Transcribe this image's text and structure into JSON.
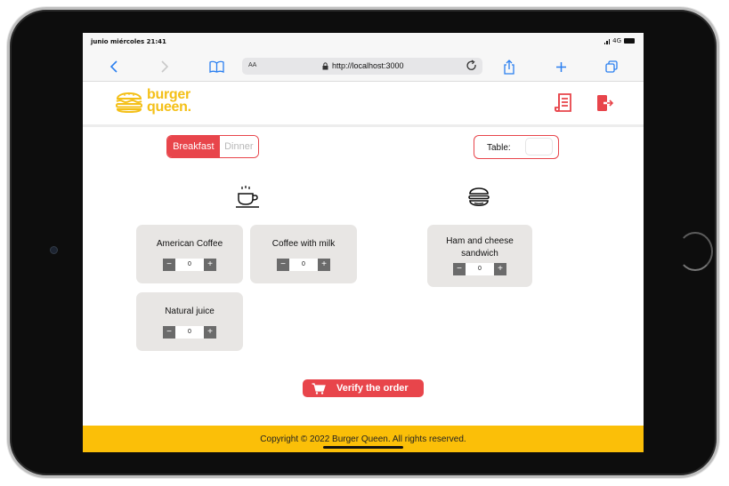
{
  "status_bar": {
    "time": "junio miércoles 21:41",
    "network": "4G"
  },
  "browser": {
    "aa_label": "AA",
    "url": "http://localhost:3000",
    "icons": [
      "back-icon",
      "forward-icon",
      "bookmarks-icon",
      "lock-icon",
      "reload-icon",
      "share-icon",
      "new-tab-icon",
      "tabs-icon"
    ]
  },
  "header": {
    "logo_line1": "burger",
    "logo_line2": "queen.",
    "brand_color": "#f4c018",
    "accent_color": "#e8454b",
    "icons": [
      "orders-list-icon",
      "logout-icon"
    ]
  },
  "menu_toggle": {
    "options": [
      "Breakfast",
      "Dinner"
    ],
    "selected": "Breakfast"
  },
  "table": {
    "label": "Table:",
    "value": ""
  },
  "categories": [
    {
      "icon": "coffee-cup-icon"
    },
    {
      "icon": "burger-icon"
    }
  ],
  "products": [
    {
      "name": "American Coffee",
      "quantity": "0"
    },
    {
      "name": "Coffee with milk",
      "quantity": "0"
    },
    {
      "name": "Natural juice",
      "quantity": "0"
    },
    {
      "name": "Ham and cheese sandwich",
      "quantity": "0"
    }
  ],
  "stepper": {
    "minus": "−",
    "plus": "+"
  },
  "verify_button": {
    "label": "Verify the order",
    "icon": "cart-icon"
  },
  "footer": {
    "text": "Copyright © 2022 Burger Queen. All rights reserved.",
    "color": "#fbbf08"
  }
}
